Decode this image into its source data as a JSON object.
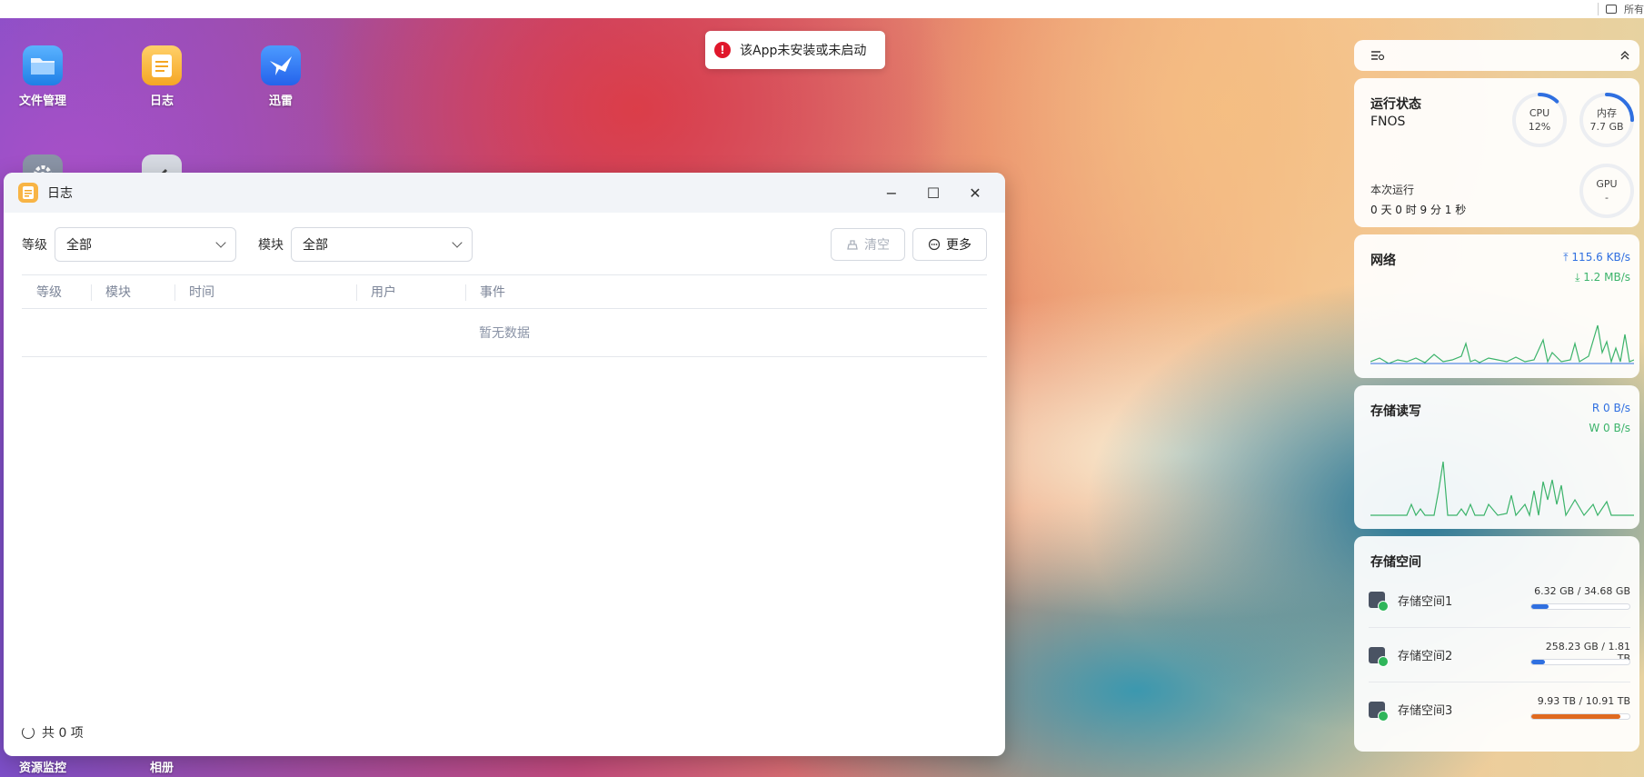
{
  "topbar": {
    "right_text": "所有"
  },
  "desktop": {
    "icons": [
      {
        "label": "文件管理",
        "icon": "folder-icon",
        "color": "#2b8ff0"
      },
      {
        "label": "日志",
        "icon": "log-icon",
        "color": "#f8b445"
      },
      {
        "label": "迅雷",
        "icon": "thunder-bird-icon",
        "color": "#3b82f6"
      },
      {
        "label": "资源监控",
        "icon": "settings-icon",
        "color": "#8a94a6"
      },
      {
        "label": "相册",
        "icon": "album-icon",
        "color": "#8a94a6"
      }
    ]
  },
  "toast": {
    "message": "该App未安装或未启动",
    "icon": "error-icon",
    "color": "#e0172b"
  },
  "log_window": {
    "title": "日志",
    "controls": {
      "minimize": "−",
      "maximize": "☐",
      "close": "✕"
    },
    "filters": {
      "level_label": "等级",
      "level_value": "全部",
      "module_label": "模块",
      "module_value": "全部"
    },
    "buttons": {
      "clear": "清空",
      "more": "更多"
    },
    "table": {
      "columns": [
        "等级",
        "模块",
        "时间",
        "用户",
        "事件"
      ],
      "empty_text": "暂无数据"
    },
    "footer": {
      "count_text": "共 0 项"
    }
  },
  "widgets": {
    "status": {
      "title": "运行状态",
      "system": "FNOS",
      "uptime_label": "本次运行",
      "uptime_value": "0 天 0 时 9 分 1 秒",
      "cpu": {
        "label": "CPU",
        "value": "12%",
        "fraction": 0.12
      },
      "memory": {
        "label": "内存",
        "value": "7.7 GB",
        "fraction": 0.25
      },
      "gpu": {
        "label": "GPU",
        "value": "-",
        "fraction": 0
      }
    },
    "network": {
      "title": "网络",
      "upload": "115.6 KB/s",
      "download": "1.2 MB/s",
      "upload_color": "#2f6fe0",
      "download_color": "#3bb36a"
    },
    "storage_io": {
      "title": "存储读写",
      "read": "R  0 B/s",
      "write": "W  0 B/s",
      "read_color": "#2f6fe0",
      "write_color": "#3bb36a"
    },
    "storage_space": {
      "title": "存储空间",
      "items": [
        {
          "name": "存储空间1",
          "used": "6.32 GB",
          "total": "34.68 GB",
          "fraction": 0.18,
          "color": "#2f6fe0"
        },
        {
          "name": "存储空间2",
          "used": "258.23 GB",
          "total": "1.81 TB",
          "fraction": 0.14,
          "color": "#2f6fe0"
        },
        {
          "name": "存储空间3",
          "used": "9.93 TB",
          "total": "10.91 TB",
          "fraction": 0.91,
          "color": "#e06a1f"
        }
      ]
    }
  }
}
